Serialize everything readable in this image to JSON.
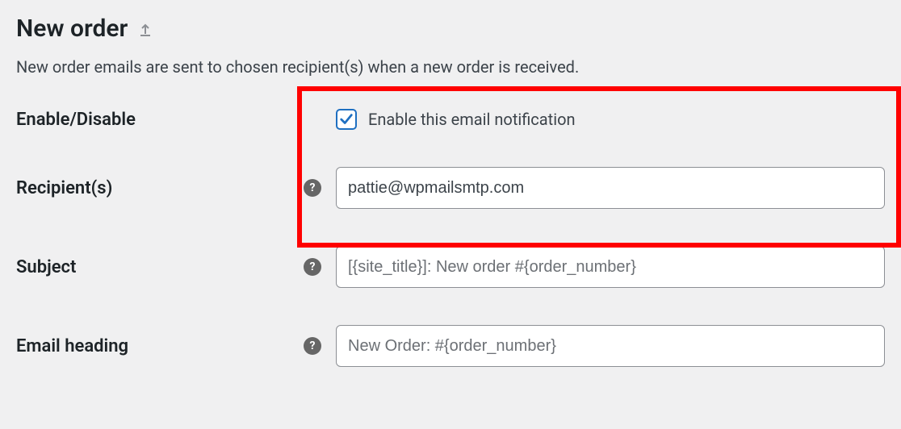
{
  "page": {
    "title": "New order",
    "description": "New order emails are sent to chosen recipient(s) when a new order is received."
  },
  "fields": {
    "enable": {
      "label": "Enable/Disable",
      "checkbox_label": "Enable this email notification",
      "checked": true
    },
    "recipients": {
      "label": "Recipient(s)",
      "value": "pattie@wpmailsmtp.com"
    },
    "subject": {
      "label": "Subject",
      "placeholder": "[{site_title}]: New order #{order_number}"
    },
    "email_heading": {
      "label": "Email heading",
      "placeholder": "New Order: #{order_number}"
    }
  },
  "icons": {
    "help": "?"
  }
}
